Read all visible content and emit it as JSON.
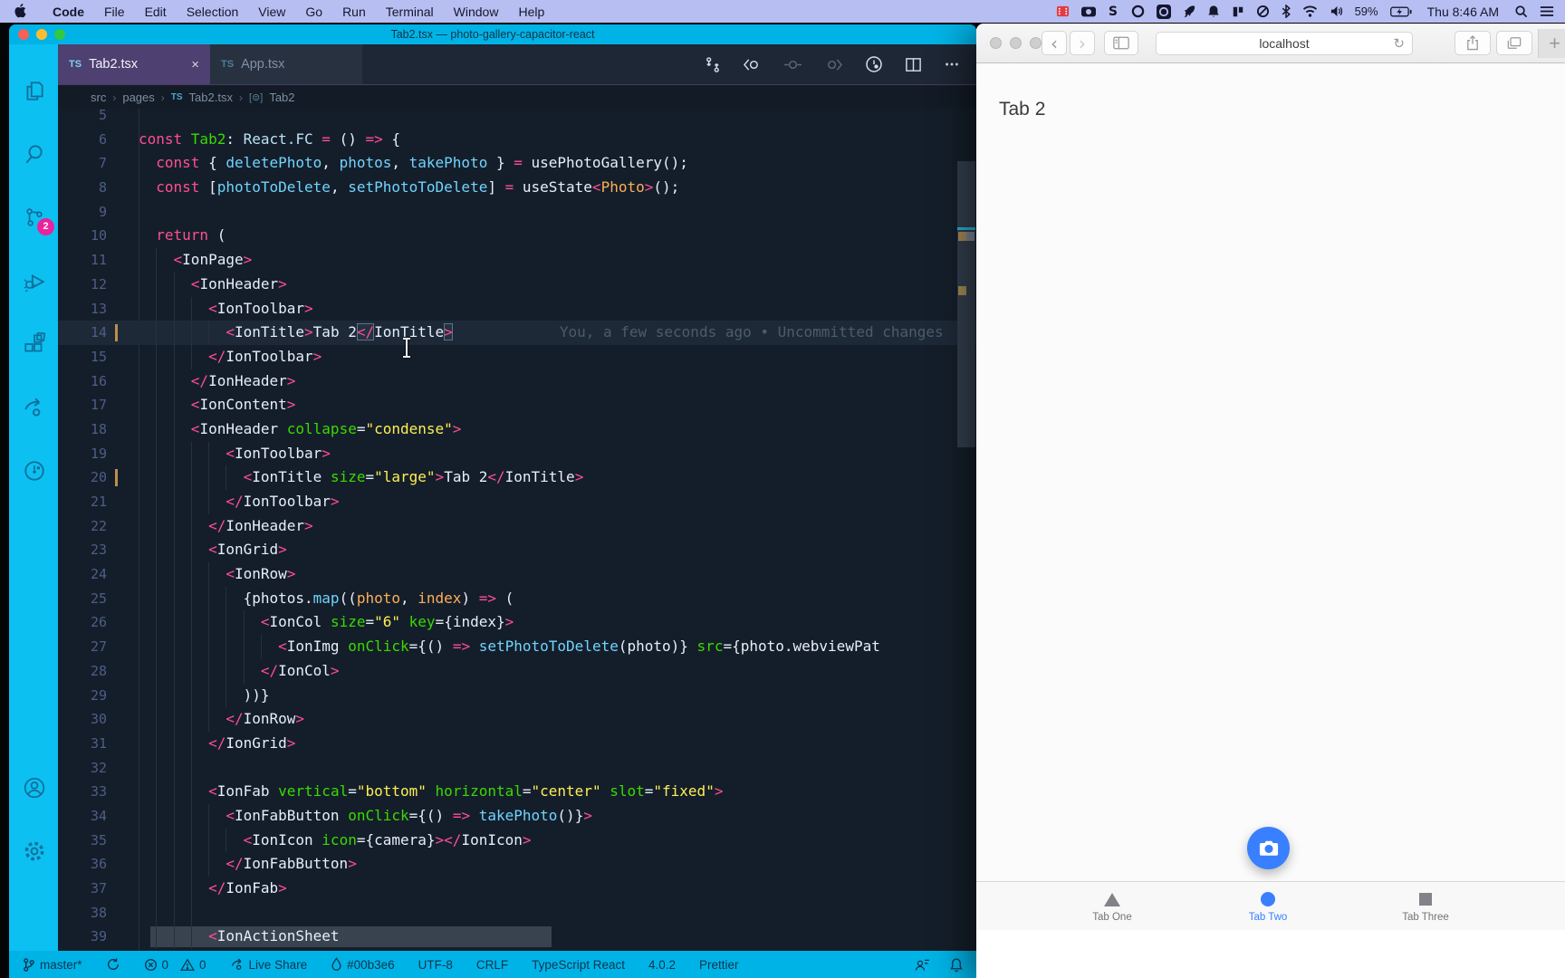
{
  "menubar": {
    "items": [
      "Code",
      "File",
      "Edit",
      "Selection",
      "View",
      "Go",
      "Run",
      "Terminal",
      "Window",
      "Help"
    ],
    "status_icons": [
      "screen-record",
      "camera",
      "s-app",
      "circle-outline",
      "circle-dot",
      "rocket",
      "bell",
      "columns",
      "do-not-disturb",
      "bluetooth",
      "wifi",
      "volume"
    ],
    "battery": "59%",
    "clock": "Thu 8:46 AM"
  },
  "vscode": {
    "window_title": "Tab2.tsx — photo-gallery-capacitor-react",
    "accent_color": "#00b3e6",
    "tabs": [
      {
        "badge": "TS",
        "label": "Tab2.tsx",
        "close": "×"
      },
      {
        "badge": "TS",
        "label": "App.tsx"
      }
    ],
    "breadcrumb": {
      "root": "src",
      "folder": "pages",
      "file_badge": "TS",
      "file": "Tab2.tsx",
      "symbol_icon": "[⊜]",
      "symbol": "Tab2"
    },
    "activity": {
      "source_control_badge": "2"
    },
    "editor": {
      "blame_line": 14,
      "lines": [
        {
          "n": 5,
          "i": 0,
          "t": []
        },
        {
          "n": 6,
          "i": 0,
          "t": [
            [
              "k",
              "const "
            ],
            [
              "g",
              "Tab2"
            ],
            [
              "w",
              ": "
            ],
            [
              "rb",
              "React.FC"
            ],
            [
              "k",
              " = "
            ],
            [
              "w",
              "() "
            ],
            [
              "k",
              "=>"
            ],
            [
              "w",
              " {"
            ]
          ]
        },
        {
          "n": 7,
          "i": 2,
          "t": [
            [
              "k",
              "const "
            ],
            [
              "w",
              "{ "
            ],
            [
              "c",
              "deletePhoto"
            ],
            [
              "w",
              ", "
            ],
            [
              "c",
              "photos"
            ],
            [
              "w",
              ", "
            ],
            [
              "c",
              "takePhoto"
            ],
            [
              "w",
              " } "
            ],
            [
              "k",
              "= "
            ],
            [
              "w",
              "usePhotoGallery();"
            ]
          ]
        },
        {
          "n": 8,
          "i": 2,
          "t": [
            [
              "k",
              "const "
            ],
            [
              "w",
              "["
            ],
            [
              "c",
              "photoToDelete"
            ],
            [
              "w",
              ", "
            ],
            [
              "c",
              "setPhotoToDelete"
            ],
            [
              "w",
              "] "
            ],
            [
              "k",
              "= "
            ],
            [
              "w",
              "useState"
            ],
            [
              "k",
              "<"
            ],
            [
              "o",
              "Photo"
            ],
            [
              "k",
              ">"
            ],
            [
              "w",
              "();"
            ]
          ]
        },
        {
          "n": 9,
          "i": 0,
          "t": []
        },
        {
          "n": 10,
          "i": 2,
          "t": [
            [
              "k",
              "return "
            ],
            [
              "w",
              "("
            ]
          ]
        },
        {
          "n": 11,
          "i": 4,
          "t": [
            [
              "k",
              "<"
            ],
            [
              "w",
              "IonPage"
            ],
            [
              "k",
              ">"
            ]
          ]
        },
        {
          "n": 12,
          "i": 6,
          "t": [
            [
              "k",
              "<"
            ],
            [
              "w",
              "IonHeader"
            ],
            [
              "k",
              ">"
            ]
          ]
        },
        {
          "n": 13,
          "i": 8,
          "t": [
            [
              "k",
              "<"
            ],
            [
              "w",
              "IonToolbar"
            ],
            [
              "k",
              ">"
            ]
          ]
        },
        {
          "n": 14,
          "i": 10,
          "hl": true,
          "mod": true,
          "blame": "You, a few seconds ago • Uncommitted changes",
          "t": [
            [
              "k",
              "<"
            ],
            [
              "w",
              "IonTitle"
            ],
            [
              "k",
              ">"
            ],
            [
              "w",
              "Tab 2"
            ],
            [
              "kb",
              "</"
            ],
            [
              "w",
              "IonTitle"
            ],
            [
              "kb",
              ">"
            ]
          ]
        },
        {
          "n": 15,
          "i": 8,
          "t": [
            [
              "k",
              "</"
            ],
            [
              "w",
              "IonToolbar"
            ],
            [
              "k",
              ">"
            ]
          ]
        },
        {
          "n": 16,
          "i": 6,
          "t": [
            [
              "k",
              "</"
            ],
            [
              "w",
              "IonHeader"
            ],
            [
              "k",
              ">"
            ]
          ]
        },
        {
          "n": 17,
          "i": 6,
          "t": [
            [
              "k",
              "<"
            ],
            [
              "w",
              "IonContent"
            ],
            [
              "k",
              ">"
            ]
          ]
        },
        {
          "n": 18,
          "i": 6,
          "t": [
            [
              "k",
              "<"
            ],
            [
              "w",
              "IonHeader "
            ],
            [
              "g",
              "collapse"
            ],
            [
              "w",
              "="
            ],
            [
              "s",
              "\"condense\""
            ],
            [
              "k",
              ">"
            ]
          ]
        },
        {
          "n": 19,
          "i": 10,
          "t": [
            [
              "k",
              "<"
            ],
            [
              "w",
              "IonToolbar"
            ],
            [
              "k",
              ">"
            ]
          ]
        },
        {
          "n": 20,
          "i": 12,
          "mod": true,
          "t": [
            [
              "k",
              "<"
            ],
            [
              "w",
              "IonTitle "
            ],
            [
              "g",
              "size"
            ],
            [
              "w",
              "="
            ],
            [
              "s",
              "\"large\""
            ],
            [
              "k",
              ">"
            ],
            [
              "w",
              "Tab 2"
            ],
            [
              "k",
              "</"
            ],
            [
              "w",
              "IonTitle"
            ],
            [
              "k",
              ">"
            ]
          ]
        },
        {
          "n": 21,
          "i": 10,
          "t": [
            [
              "k",
              "</"
            ],
            [
              "w",
              "IonToolbar"
            ],
            [
              "k",
              ">"
            ]
          ]
        },
        {
          "n": 22,
          "i": 8,
          "t": [
            [
              "k",
              "</"
            ],
            [
              "w",
              "IonHeader"
            ],
            [
              "k",
              ">"
            ]
          ]
        },
        {
          "n": 23,
          "i": 8,
          "t": [
            [
              "k",
              "<"
            ],
            [
              "w",
              "IonGrid"
            ],
            [
              "k",
              ">"
            ]
          ]
        },
        {
          "n": 24,
          "i": 10,
          "t": [
            [
              "k",
              "<"
            ],
            [
              "w",
              "IonRow"
            ],
            [
              "k",
              ">"
            ]
          ]
        },
        {
          "n": 25,
          "i": 12,
          "t": [
            [
              "w",
              "{photos."
            ],
            [
              "c",
              "map"
            ],
            [
              "w",
              "(("
            ],
            [
              "o",
              "photo"
            ],
            [
              "w",
              ", "
            ],
            [
              "o",
              "index"
            ],
            [
              "w",
              ") "
            ],
            [
              "k",
              "=>"
            ],
            [
              "w",
              " ("
            ]
          ]
        },
        {
          "n": 26,
          "i": 14,
          "t": [
            [
              "k",
              "<"
            ],
            [
              "w",
              "IonCol "
            ],
            [
              "g",
              "size"
            ],
            [
              "w",
              "="
            ],
            [
              "s",
              "\"6\""
            ],
            [
              "w",
              " "
            ],
            [
              "g",
              "key"
            ],
            [
              "w",
              "={index}"
            ],
            [
              "k",
              ">"
            ]
          ]
        },
        {
          "n": 27,
          "i": 16,
          "t": [
            [
              "k",
              "<"
            ],
            [
              "w",
              "IonImg "
            ],
            [
              "g",
              "onClick"
            ],
            [
              "w",
              "={() "
            ],
            [
              "k",
              "=> "
            ],
            [
              "c",
              "setPhotoToDelete"
            ],
            [
              "w",
              "(photo)} "
            ],
            [
              "g",
              "src"
            ],
            [
              "w",
              "={photo.webviewPat"
            ]
          ]
        },
        {
          "n": 28,
          "i": 14,
          "t": [
            [
              "k",
              "</"
            ],
            [
              "w",
              "IonCol"
            ],
            [
              "k",
              ">"
            ]
          ]
        },
        {
          "n": 29,
          "i": 12,
          "t": [
            [
              "w",
              "))}"
            ]
          ]
        },
        {
          "n": 30,
          "i": 10,
          "t": [
            [
              "k",
              "</"
            ],
            [
              "w",
              "IonRow"
            ],
            [
              "k",
              ">"
            ]
          ]
        },
        {
          "n": 31,
          "i": 8,
          "t": [
            [
              "k",
              "</"
            ],
            [
              "w",
              "IonGrid"
            ],
            [
              "k",
              ">"
            ]
          ]
        },
        {
          "n": 32,
          "i": 8,
          "t": []
        },
        {
          "n": 33,
          "i": 8,
          "t": [
            [
              "k",
              "<"
            ],
            [
              "w",
              "IonFab "
            ],
            [
              "g",
              "vertical"
            ],
            [
              "w",
              "="
            ],
            [
              "s",
              "\"bottom\""
            ],
            [
              "w",
              " "
            ],
            [
              "g",
              "horizontal"
            ],
            [
              "w",
              "="
            ],
            [
              "s",
              "\"center\""
            ],
            [
              "w",
              " "
            ],
            [
              "g",
              "slot"
            ],
            [
              "w",
              "="
            ],
            [
              "s",
              "\"fixed\""
            ],
            [
              "k",
              ">"
            ]
          ]
        },
        {
          "n": 34,
          "i": 10,
          "t": [
            [
              "k",
              "<"
            ],
            [
              "w",
              "IonFabButton "
            ],
            [
              "g",
              "onClick"
            ],
            [
              "w",
              "={() "
            ],
            [
              "k",
              "=> "
            ],
            [
              "c",
              "takePhoto"
            ],
            [
              "w",
              "()}"
            ],
            [
              "k",
              ">"
            ]
          ]
        },
        {
          "n": 35,
          "i": 12,
          "t": [
            [
              "k",
              "<"
            ],
            [
              "w",
              "IonIcon "
            ],
            [
              "g",
              "icon"
            ],
            [
              "w",
              "={camera}"
            ],
            [
              "k",
              ">"
            ],
            [
              "k",
              "</"
            ],
            [
              "w",
              "IonIcon"
            ],
            [
              "k",
              ">"
            ]
          ]
        },
        {
          "n": 36,
          "i": 10,
          "t": [
            [
              "k",
              "</"
            ],
            [
              "w",
              "IonFabButton"
            ],
            [
              "k",
              ">"
            ]
          ]
        },
        {
          "n": 37,
          "i": 8,
          "t": [
            [
              "k",
              "</"
            ],
            [
              "w",
              "IonFab"
            ],
            [
              "k",
              ">"
            ]
          ]
        },
        {
          "n": 38,
          "i": 8,
          "t": []
        },
        {
          "n": 39,
          "i": 8,
          "band": true,
          "t": [
            [
              "k",
              "<"
            ],
            [
              "w",
              "IonActionSheet"
            ]
          ]
        }
      ]
    },
    "status": {
      "branch": "master*",
      "errors": "0",
      "warnings": "0",
      "live_share": "Live Share",
      "peacock_color": "#00b3e6",
      "encoding": "UTF-8",
      "eol": "CRLF",
      "language": "TypeScript React",
      "version": "4.0.2",
      "formatter": "Prettier"
    }
  },
  "safari": {
    "url": "localhost",
    "page_title": "Tab 2",
    "fab_icon": "camera",
    "tabs": [
      {
        "label": "Tab One",
        "icon": "triangle"
      },
      {
        "label": "Tab Two",
        "icon": "circle",
        "active": true
      },
      {
        "label": "Tab Three",
        "icon": "square"
      }
    ]
  }
}
